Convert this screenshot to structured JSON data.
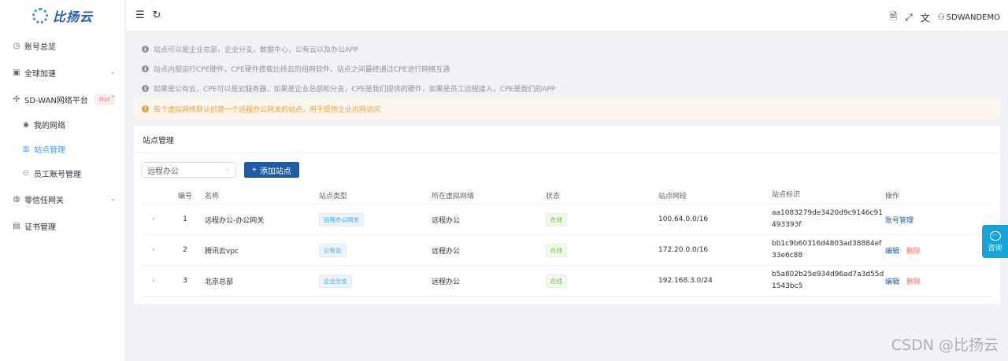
{
  "brand": {
    "name": "比扬云"
  },
  "sidebar": {
    "items": [
      {
        "label": "账号总览",
        "icon": "dashboard-icon"
      },
      {
        "label": "全球加速",
        "icon": "globe-icon"
      },
      {
        "label": "SD-WAN网络平台",
        "icon": "network-icon",
        "badge": "Hot"
      },
      {
        "label": "零信任网关",
        "icon": "shield-icon"
      },
      {
        "label": "证书管理",
        "icon": "certificate-icon"
      }
    ],
    "sub_items": [
      {
        "label": "我的网络",
        "icon": "dot-icon"
      },
      {
        "label": "站点管理",
        "icon": "chart-icon"
      },
      {
        "label": "员工账号管理",
        "icon": "user-icon"
      }
    ]
  },
  "topbar": {
    "username": "SDWANDEMO"
  },
  "notices": [
    "站点可以是企业总部，企业分支，数据中心，公有云以及办公APP",
    "站点内部运行CPE硬件，CPE硬件搭载比扬云的组网软件，站点之间最终通过CPE进行网络互通",
    "如果是公有云，CPE可以是云服务器，如果是企业总部和分支，CPE是我们提供的硬件，如果是员工远程接入，CPE是我们的APP"
  ],
  "warning": "每个虚拟网络默认创建一个远程办公网关的站点，用于提供企业内网访问",
  "card": {
    "title": "站点管理",
    "filter_value": "远程办公",
    "add_button": "添加站点"
  },
  "table": {
    "headers": [
      "编号",
      "名称",
      "站点类型",
      "所在虚拟网络",
      "状态",
      "站点网段",
      "站点标识",
      "操作"
    ],
    "rows": [
      {
        "no": "1",
        "name": "远程办公-办公网关",
        "type": "远程办公网关",
        "vnet": "远程办公",
        "status": "在线",
        "segment": "100.64.0.0/16",
        "id": "aa1083279de3420d9c9146c91493393f",
        "ops": [
          "账号管理"
        ]
      },
      {
        "no": "2",
        "name": "腾讯云vpc",
        "type": "公有云",
        "vnet": "远程办公",
        "status": "在线",
        "segment": "172.20.0.0/16",
        "id": "bb1c9b60316d4803ad38884ef33e6c88",
        "ops": [
          "编辑",
          "删除"
        ]
      },
      {
        "no": "3",
        "name": "北京总部",
        "type": "企业分支",
        "vnet": "远程办公",
        "status": "在线",
        "segment": "192.168.3.0/24",
        "id": "b5a802b25e934d96ad7a3d55d1543bc5",
        "ops": [
          "编辑",
          "删除"
        ]
      }
    ]
  },
  "consult": {
    "label": "咨询"
  },
  "watermark": "CSDN @比扬云"
}
